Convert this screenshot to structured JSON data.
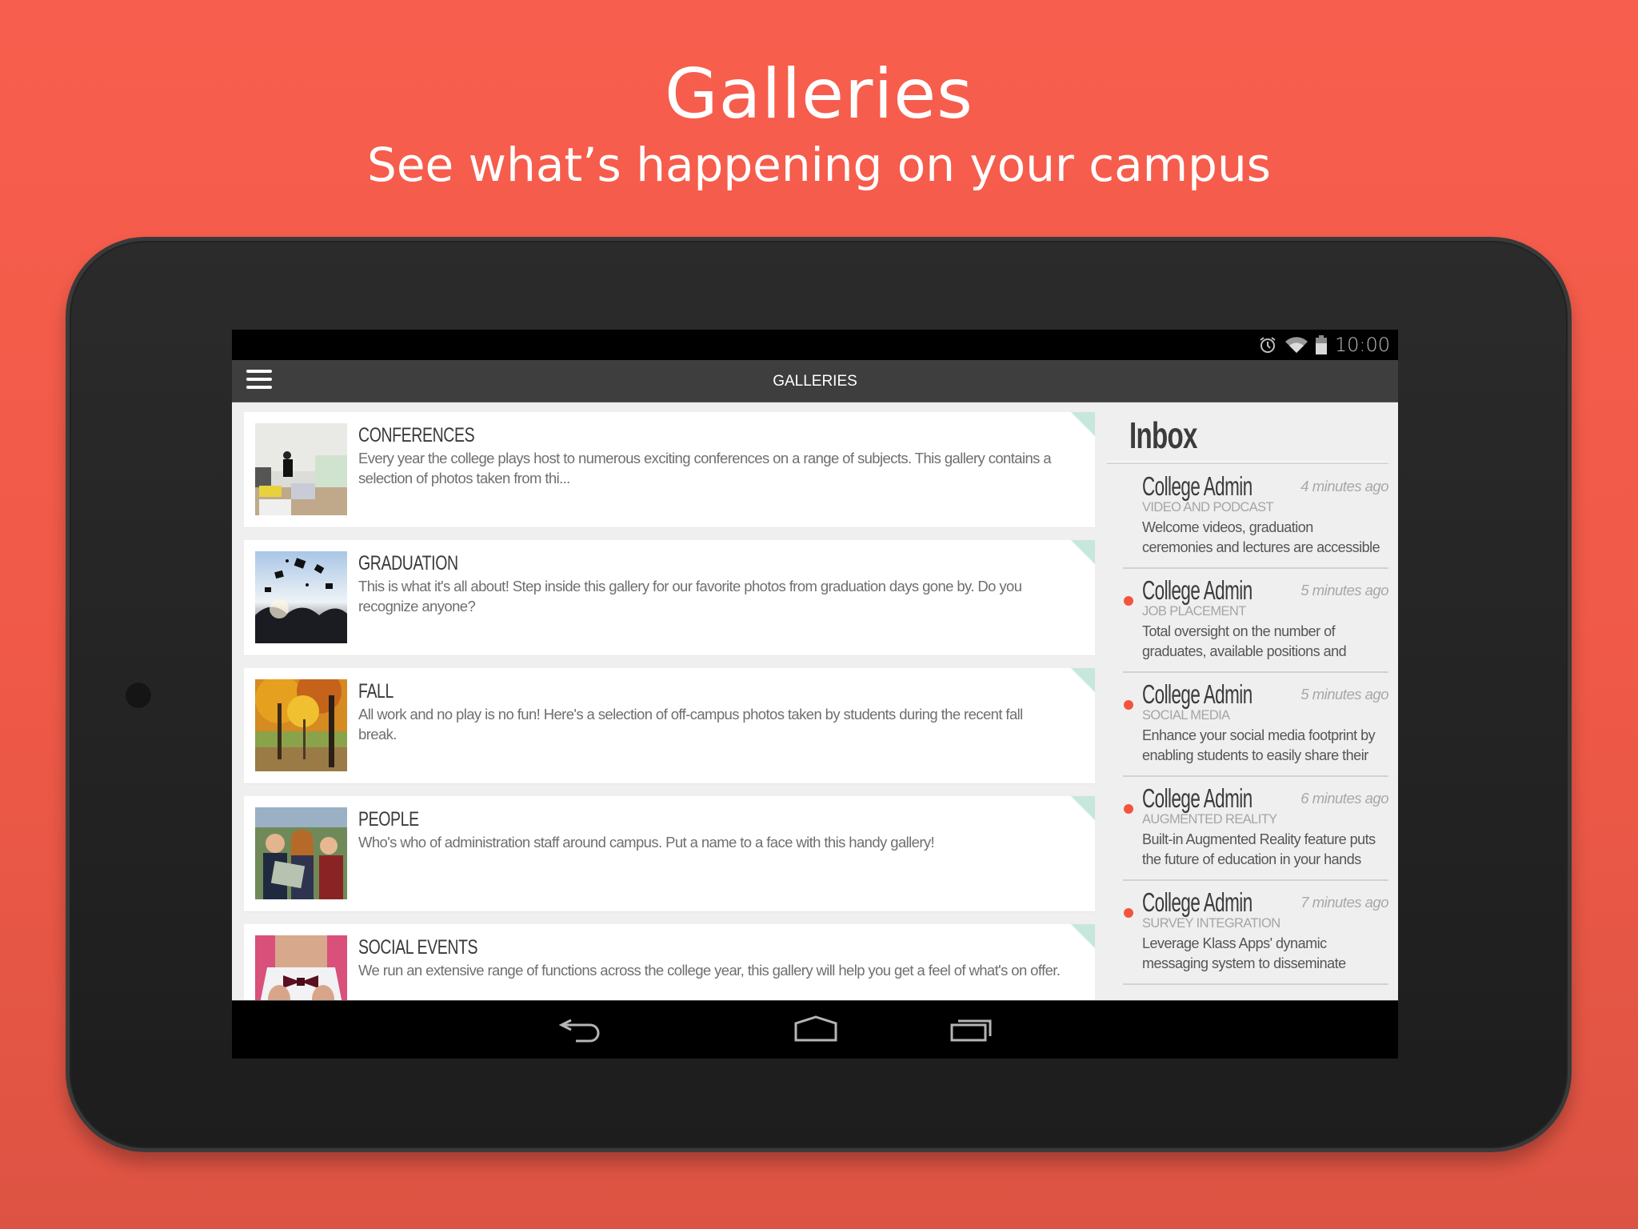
{
  "promo": {
    "title": "Galleries",
    "subtitle": "See what’s happening on your campus"
  },
  "status_bar": {
    "icons": [
      "alarm-icon",
      "wifi-icon",
      "battery-icon"
    ],
    "time": "10:00"
  },
  "app_bar": {
    "menu_icon": "hamburger-menu-icon",
    "title": "GALLERIES"
  },
  "galleries": [
    {
      "title": "CONFERENCES",
      "description": "Every year the college plays host to numerous exciting conferences on a range of subjects.  This gallery contains a selection of photos taken from thi...",
      "thumbnail": "conference-photo"
    },
    {
      "title": "GRADUATION",
      "description": "This is what it's all about!  Step inside this gallery for our favorite photos from graduation days gone by.  Do you recognize anyone?",
      "thumbnail": "graduation-photo"
    },
    {
      "title": "FALL",
      "description": "All work and no play is no fun!  Here's a selection of off-campus photos taken by students during the recent fall break.",
      "thumbnail": "fall-photo"
    },
    {
      "title": "PEOPLE",
      "description": "Who's who of administration staff around campus.  Put a name to a face with this handy gallery!",
      "thumbnail": "people-photo"
    },
    {
      "title": "SOCIAL EVENTS",
      "description": "We run an extensive range of functions across the college year, this gallery will help you get a feel of what's on offer.",
      "thumbnail": "social-events-photo"
    }
  ],
  "inbox": {
    "title": "Inbox",
    "messages": [
      {
        "sender": "College Admin",
        "time": "4 minutes ago",
        "category": "VIDEO AND PODCAST",
        "preview": "Welcome videos, graduation ceremonies and lectures are accessible",
        "unread": false
      },
      {
        "sender": "College Admin",
        "time": "5 minutes ago",
        "category": "JOB PLACEMENT",
        "preview": "Total oversight on the number of graduates, available positions and",
        "unread": true
      },
      {
        "sender": "College Admin",
        "time": "5 minutes ago",
        "category": "SOCIAL MEDIA",
        "preview": "Enhance your social media footprint by enabling students to easily share their",
        "unread": true
      },
      {
        "sender": "College Admin",
        "time": "6 minutes ago",
        "category": "AUGMENTED REALITY",
        "preview": "Built-in Augmented Reality feature puts the future of education in your hands",
        "unread": true
      },
      {
        "sender": "College Admin",
        "time": "7 minutes ago",
        "category": "SURVEY INTEGRATION",
        "preview": "Leverage Klass Apps' dynamic messaging system to disseminate",
        "unread": true
      }
    ]
  },
  "nav_bar": {
    "buttons": [
      "back-icon",
      "home-icon",
      "recent-apps-icon"
    ]
  },
  "colors": {
    "background_top": "#f85e4d",
    "background_bottom": "#dd5343",
    "unread_dot": "#f2553f",
    "card_corner": "#c7e7da",
    "app_bar": "#3e3e3e"
  }
}
